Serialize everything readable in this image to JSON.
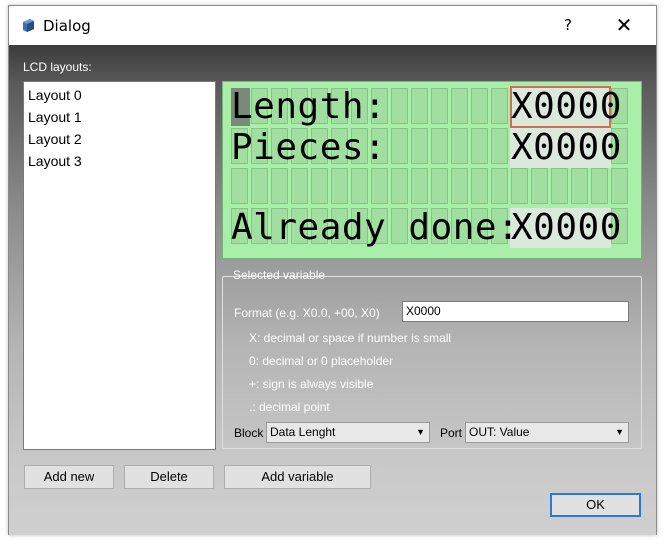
{
  "window": {
    "title": "Dialog",
    "help_label": "?",
    "close_label": "✕"
  },
  "layouts": {
    "label": "LCD layouts:",
    "items": [
      "Layout 0",
      "Layout 1",
      "Layout 2",
      "Layout 3"
    ]
  },
  "lcd": {
    "rows": [
      "Length:",
      "Pieces:",
      "",
      "Already done:"
    ],
    "variables": [
      "X0000",
      "X0000",
      "X0000"
    ],
    "background_color": "#a9eea9"
  },
  "selected_variable": {
    "group_title": "Selected variable",
    "format_label": "Format (e.g. X0.0, +00, X0)",
    "format_value": "X0000",
    "help_lines": [
      "X: decimal or space if number is small",
      "0: decimal or 0 placeholder",
      "+: sign is always visible",
      ".: decimal point"
    ],
    "block_label": "Block",
    "block_value": "Data Lenght",
    "port_label": "Port",
    "port_value": "OUT: Value"
  },
  "buttons": {
    "add_new": "Add new",
    "delete": "Delete",
    "add_variable": "Add variable",
    "ok": "OK"
  }
}
